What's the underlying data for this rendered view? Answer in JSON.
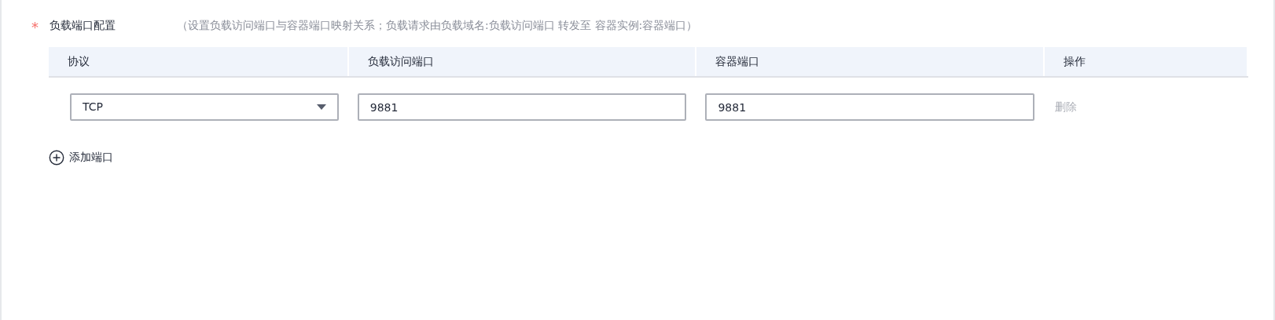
{
  "field": {
    "required_mark": "*",
    "label": "负载端口配置",
    "hint": "（设置负载访问端口与容器端口映射关系；负载请求由负载域名:负载访问端口 转发至 容器实例:容器端口）"
  },
  "table": {
    "columns": [
      "协议",
      "负载访问端口",
      "容器端口",
      "操作"
    ],
    "rows": [
      {
        "protocol": "TCP",
        "access_port": "9881",
        "container_port": "9881",
        "action": {
          "label": "删除",
          "disabled": true
        }
      }
    ]
  },
  "add_button": {
    "label": "添加端口"
  }
}
